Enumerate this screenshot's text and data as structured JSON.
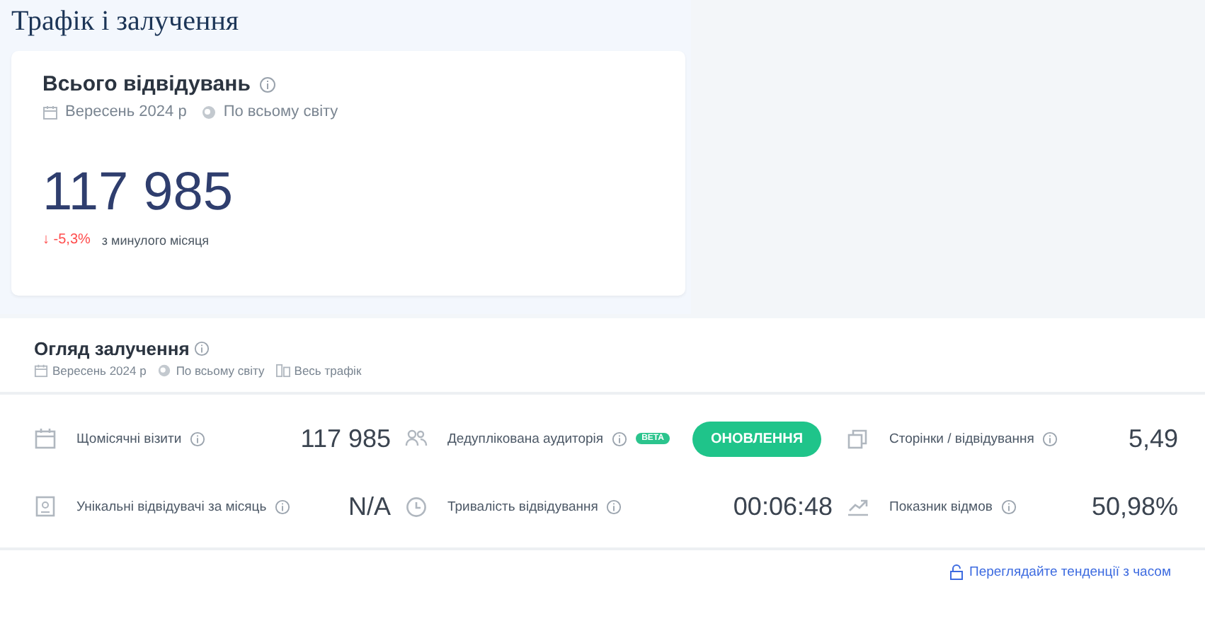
{
  "page_title": "Трафік і залучення",
  "total_visits": {
    "title": "Всього відвідувань",
    "period": "Вересень 2024 р",
    "region": "По всьому світу",
    "value": "117 985",
    "change": "↓ -5,3%",
    "change_note": "з минулого місяця"
  },
  "engagement": {
    "title": "Огляд залучення",
    "period": "Вересень 2024 р",
    "region": "По всьому світу",
    "traffic": "Весь трафік",
    "metrics": [
      {
        "kind": "value",
        "label": "Щомісячні візити",
        "value": "117 985"
      },
      {
        "kind": "upgrade",
        "label": "Дедуплікована аудиторія",
        "badge": "BETA",
        "button": "ОНОВЛЕННЯ"
      },
      {
        "kind": "value",
        "label": "Сторінки / відвідування",
        "value": "5,49"
      },
      {
        "kind": "value",
        "label": "Унікальні відвідувачі за місяць",
        "value": "N/A"
      },
      {
        "kind": "value",
        "label": "Тривалість відвідування",
        "value": "00:06:48"
      },
      {
        "kind": "value",
        "label": "Показник відмов",
        "value": "50,98%"
      }
    ],
    "trend_link": "Переглядайте тенденції з часом"
  }
}
